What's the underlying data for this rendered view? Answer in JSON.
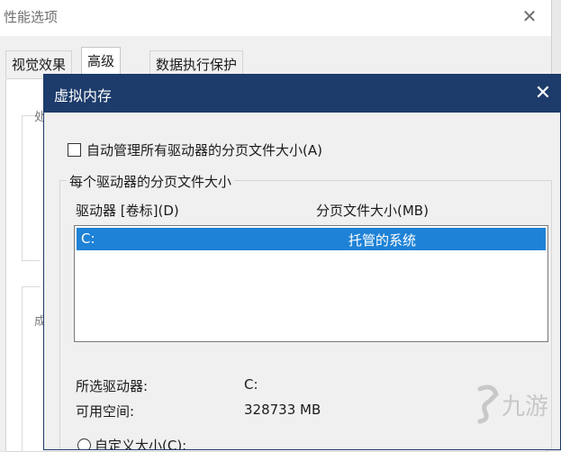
{
  "background_window": {
    "title": "性能选项",
    "tabs": [
      {
        "label": "视觉效果",
        "active": false
      },
      {
        "label": "高级",
        "active": true
      },
      {
        "label": "数据执行保护",
        "active": false
      }
    ],
    "partial_glyphs": [
      "处",
      "成"
    ]
  },
  "dialog": {
    "title": "虚拟内存",
    "auto_manage_label": "自动管理所有驱动器的分页文件大小(A)",
    "auto_manage_checked": false,
    "group_caption": "每个驱动器的分页文件大小",
    "columns": {
      "drive": "驱动器 [卷标](D)",
      "size": "分页文件大小(MB)"
    },
    "drives": [
      {
        "drive": "C:",
        "size": "托管的系统",
        "selected": true
      }
    ],
    "selected_drive_label": "所选驱动器:",
    "selected_drive_value": "C:",
    "free_space_label": "可用空间:",
    "free_space_value": "328733 MB",
    "custom_size_label": "自定义大小(C):"
  },
  "watermark": {
    "text": "九游",
    "color": "#c8c8c8"
  }
}
